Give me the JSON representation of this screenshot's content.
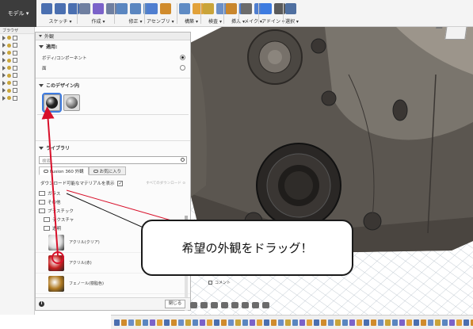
{
  "toolbar": {
    "mode": "モデル ▾",
    "groups": [
      {
        "label": "スケッチ ▾",
        "colors": [
          "#4a6fb0",
          "#4a6fb0",
          "#4a6fb0"
        ]
      },
      {
        "label": "作成 ▾",
        "colors": [
          "#6f7fa0",
          "#7b62c9",
          "#6f7fa0"
        ]
      },
      {
        "label": "修正 ▾",
        "colors": [
          "#5a86c0",
          "#5a86c0",
          "#5a86c0"
        ]
      },
      {
        "label": "アセンブリ ▾",
        "colors": [
          "#4f7ed0",
          "#d08b2c"
        ]
      },
      {
        "label": "構築 ▾",
        "colors": [
          "#5f8bc4",
          "#e2a23a"
        ]
      },
      {
        "label": "検査 ▾",
        "colors": [
          "#c9a43a",
          "#6b8fc7"
        ]
      },
      {
        "label": "挿入 ▾",
        "colors": [
          "#c9862c",
          "#4f7ed0"
        ]
      },
      {
        "label": "メイク ▾",
        "colors": [
          "#6b6b6b",
          "#4f7ed0"
        ]
      },
      {
        "label": "アドイン ▾",
        "colors": [
          "#3d7be0",
          "#5a5a5a"
        ]
      },
      {
        "label": "選択 ▾",
        "colors": [
          "#4f6fa0"
        ]
      }
    ]
  },
  "browser": {
    "title": "ブラウザ",
    "row_count": 9
  },
  "dialog": {
    "title": "外観",
    "apply_section": "適用:",
    "apply_options": [
      {
        "label": "ボディ/コンポーネント",
        "selected": true
      },
      {
        "label": "面",
        "selected": false
      }
    ],
    "in_design_section": "このデザイン内",
    "swatches": [
      {
        "name": "dark-metal",
        "color": "#222222"
      },
      {
        "name": "chrome",
        "color": "#8c8c8c"
      }
    ],
    "library_section": "ライブラリ",
    "search_placeholder": "検索",
    "tabs": [
      {
        "label": "Fusion 360 外観",
        "active": true
      },
      {
        "label": "お気に入り",
        "active": false
      }
    ],
    "download_label": "ダウンロード可能なマテリアルを表示",
    "download_all_label": "すべてのダウンロード ⊙",
    "folders": [
      {
        "label": "ガラス",
        "indent": 0
      },
      {
        "label": "その他",
        "indent": 0
      },
      {
        "label": "プラスチック",
        "indent": 0
      },
      {
        "label": "テクスチャ",
        "indent": 1
      },
      {
        "label": "透明",
        "indent": 1
      }
    ],
    "materials": [
      {
        "label": "アクリル(クリア)",
        "color": "#dddddd"
      },
      {
        "label": "アクリル(赤)",
        "color": "#c42020"
      },
      {
        "label": "フェノール(樹脂色)",
        "color": "#b07a22"
      }
    ],
    "close_label": "閉じる",
    "info_glyph": "i"
  },
  "callout": {
    "text": "希望の外観をドラッグ！"
  },
  "comment": {
    "label": "コメント"
  },
  "colors": {
    "arrow": "#d8102a",
    "camera_body": "#5b5650",
    "grid": "#b9c3cc"
  }
}
